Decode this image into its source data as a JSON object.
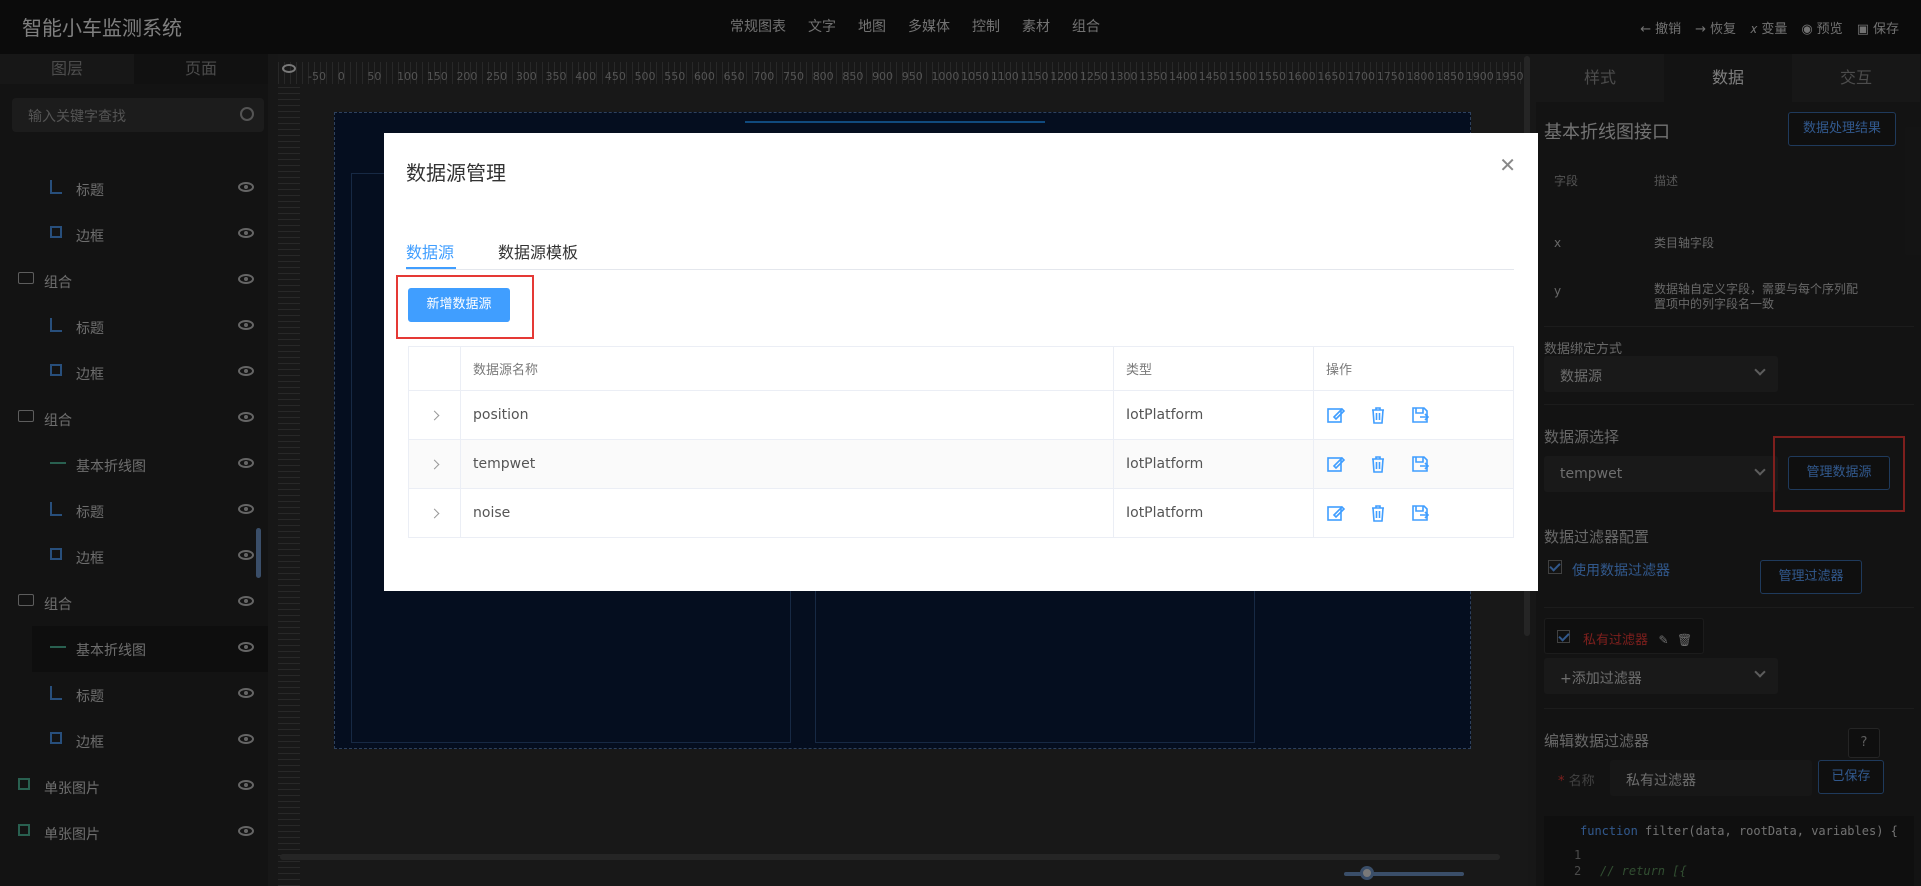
{
  "app": {
    "title": "智能小车监测系统",
    "menu": [
      "常规图表",
      "文字",
      "地图",
      "多媒体",
      "控制",
      "素材",
      "组合"
    ],
    "actions": {
      "undo": "撤销",
      "redo": "恢复",
      "transform": "变量",
      "preview": "预览",
      "save": "保存"
    }
  },
  "left": {
    "tabs": [
      "图层",
      "页面"
    ],
    "search_placeholder": "输入关键字查找",
    "tree": [
      {
        "label": "标题",
        "icon": "chart-icon",
        "indent": true
      },
      {
        "label": "边框",
        "icon": "border-icon",
        "indent": true
      },
      {
        "label": "组合",
        "icon": "folder-icon",
        "indent": false
      },
      {
        "label": "标题",
        "icon": "chart-icon",
        "indent": true
      },
      {
        "label": "边框",
        "icon": "border-icon",
        "indent": true
      },
      {
        "label": "组合",
        "icon": "folder-icon",
        "indent": false
      },
      {
        "label": "基本折线图",
        "icon": "line-chart-icon",
        "indent": true
      },
      {
        "label": "标题",
        "icon": "chart-icon",
        "indent": true
      },
      {
        "label": "边框",
        "icon": "border-icon",
        "indent": true
      },
      {
        "label": "组合",
        "icon": "folder-icon",
        "indent": false
      },
      {
        "label": "基本折线图",
        "icon": "line-chart-icon",
        "indent": true,
        "selected": true
      },
      {
        "label": "标题",
        "icon": "chart-icon",
        "indent": true
      },
      {
        "label": "边框",
        "icon": "border-icon",
        "indent": true
      },
      {
        "label": "单张图片",
        "icon": "image-icon",
        "indent": false
      },
      {
        "label": "单张图片",
        "icon": "image-icon",
        "indent": false
      }
    ]
  },
  "canvas": {
    "ruler_marks": [
      "-50",
      "0",
      "50",
      "100",
      "150",
      "200",
      "250",
      "300",
      "350",
      "400",
      "450",
      "500",
      "550",
      "600",
      "650",
      "700",
      "750",
      "800",
      "850",
      "900",
      "950",
      "1000",
      "1050",
      "1100",
      "1150",
      "1200",
      "1250",
      "1300",
      "1350",
      "1400",
      "1450",
      "1500",
      "1550",
      "1600",
      "1650",
      "1700",
      "1750",
      "1800",
      "1850",
      "1900",
      "1950"
    ]
  },
  "right": {
    "tabs": [
      "样式",
      "数据",
      "交互"
    ],
    "interface_title": "基本折线图接口",
    "result_btn": "数据处理结果",
    "field_header": "字段",
    "desc_header": "描述",
    "fields": [
      {
        "field": "x",
        "desc": "类目轴字段"
      },
      {
        "field": "y",
        "desc": "数据轴自定义字段，需要与每个序列配置项中的列字段名一致"
      }
    ],
    "binding_label": "数据绑定方式",
    "binding_value": "数据源",
    "source_label": "数据源选择",
    "source_value": "tempwet",
    "manage_btn": "管理数据源",
    "filter_label": "数据过滤器配置",
    "use_filter": "使用数据过滤器",
    "manage_filter_btn": "管理过滤器",
    "private_filter": "私有过滤器",
    "add_filter": "+添加过滤器",
    "edit_filter_label": "编辑数据过滤器",
    "help": "?",
    "name_label": "名称",
    "name_value": "私有过滤器",
    "saved": "已保存",
    "code_line": "function filter(data, rootData, variables) {",
    "code_keyword": "function",
    "code_rest": " filter(data, rootData, variables) {",
    "line_numbers": [
      "1",
      "2"
    ],
    "code_comment": "// return [{"
  },
  "modal": {
    "title": "数据源管理",
    "tabs": [
      "数据源",
      "数据源模板"
    ],
    "add_btn": "新增数据源",
    "columns": [
      "数据源名称",
      "类型",
      "操作"
    ],
    "rows": [
      {
        "name": "position",
        "type": "IotPlatform"
      },
      {
        "name": "tempwet",
        "type": "IotPlatform"
      },
      {
        "name": "noise",
        "type": "IotPlatform"
      }
    ],
    "accent": "#409eff",
    "highlight": "#e53935"
  }
}
